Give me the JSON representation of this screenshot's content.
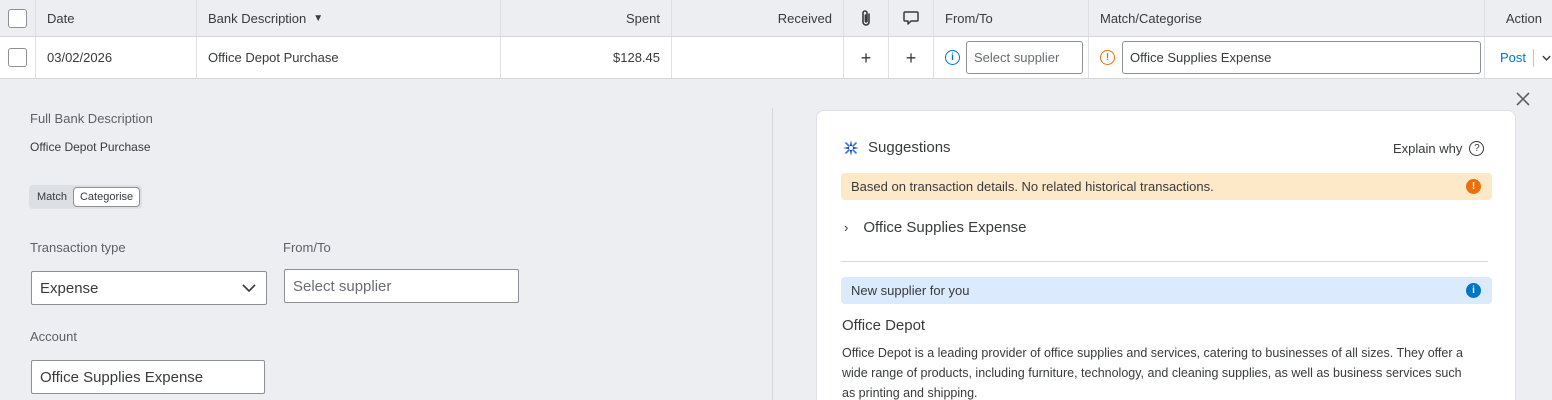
{
  "table": {
    "headers": {
      "date": "Date",
      "bank_description": "Bank Description",
      "spent": "Spent",
      "received": "Received",
      "from_to": "From/To",
      "match_categorise": "Match/Categorise",
      "action": "Action"
    },
    "row": {
      "date": "03/02/2026",
      "bank_description": "Office Depot Purchase",
      "spent": "$128.45",
      "received": "",
      "from_to_placeholder": "Select supplier",
      "category": "Office Supplies Expense",
      "action": "Post"
    }
  },
  "details": {
    "full_desc_label": "Full Bank Description",
    "full_desc_value": "Office Depot Purchase",
    "toggle": {
      "match": "Match",
      "categorise": "Categorise",
      "active": "categorise"
    },
    "transaction_type_label": "Transaction type",
    "transaction_type_value": "Expense",
    "from_to_label": "From/To",
    "from_to_placeholder": "Select supplier",
    "account_label": "Account",
    "account_value": "Office Supplies Expense"
  },
  "suggestions": {
    "title": "Suggestions",
    "explain": "Explain why",
    "warning_banner": "Based on transaction details. No related historical transactions.",
    "item": "Office Supplies Expense",
    "info_banner": "New supplier for you",
    "supplier_name": "Office Depot",
    "supplier_desc": "Office Depot is a leading provider of office supplies and services, catering to businesses of all sizes. They offer a wide range of products, including furniture, technology, and cleaning supplies, as well as business services such as printing and shipping."
  },
  "colors": {
    "link": "#0077c5",
    "warning": "#e8700a",
    "warning_bg": "#fde8c8",
    "info_bg": "#dbeafc",
    "panel_bg": "#eceef1"
  },
  "icons": [
    "checkbox",
    "sort-down-icon",
    "paperclip-icon",
    "comment-icon",
    "plus-icon",
    "info-icon",
    "warning-icon",
    "chevron-down-icon",
    "close-icon",
    "sparkle-icon",
    "help-icon",
    "chevron-right-icon"
  ]
}
